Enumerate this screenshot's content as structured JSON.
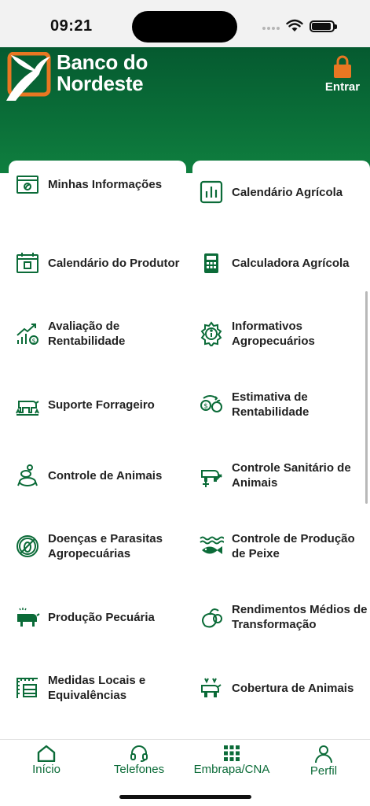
{
  "status_bar": {
    "time": "09:21"
  },
  "brand": {
    "line1": "Banco do",
    "line2": "Nordeste"
  },
  "login": {
    "label": "Entrar"
  },
  "colors": {
    "header_green": "#0a6e38",
    "accent_orange": "#e87722",
    "icon_green": "#0b6b38"
  },
  "menu": {
    "left": [
      {
        "label": "Minhas Informações",
        "icon": "id-card-icon"
      },
      {
        "label": "Calendário do Produtor",
        "icon": "calendar-icon"
      },
      {
        "label": "Avaliação de Rentabilidade",
        "icon": "growth-chart-icon"
      },
      {
        "label": "Suporte Forrageiro",
        "icon": "cattle-feed-icon"
      },
      {
        "label": "Controle de Animais",
        "icon": "animals-stack-icon"
      },
      {
        "label": "Doenças e Parasitas Agropecuárias",
        "icon": "no-pest-icon"
      },
      {
        "label": "Produção Pecuária",
        "icon": "cow-icon"
      },
      {
        "label": "Medidas Locais e Equivalências",
        "icon": "measure-icon"
      }
    ],
    "right": [
      {
        "label": "Calendário Agrícola",
        "icon": "bar-chart-icon"
      },
      {
        "label": "Calculadora Agrícola",
        "icon": "calculator-icon"
      },
      {
        "label": "Informativos Agropecuários",
        "icon": "info-gear-icon"
      },
      {
        "label": "Estimativa de Rentabilidade",
        "icon": "money-cycle-icon"
      },
      {
        "label": "Controle Sanitário de Animais",
        "icon": "animal-health-icon"
      },
      {
        "label": "Controle de Produção de Peixe",
        "icon": "fish-icon"
      },
      {
        "label": "Rendimentos Médios de Transformação",
        "icon": "fruit-icon"
      },
      {
        "label": "Cobertura de Animais",
        "icon": "animal-cover-icon"
      }
    ]
  },
  "tabbar": {
    "tabs": [
      {
        "label": "Início",
        "icon": "home-icon"
      },
      {
        "label": "Telefones",
        "icon": "headset-icon"
      },
      {
        "label": "Embrapa/CNA",
        "icon": "grid-icon"
      },
      {
        "label": "Perfil",
        "icon": "person-icon"
      }
    ]
  }
}
